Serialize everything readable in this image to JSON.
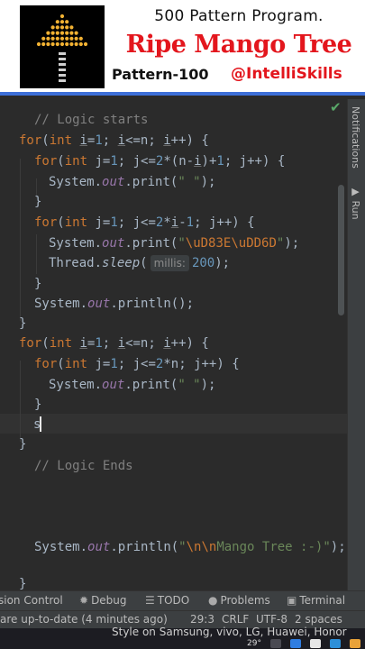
{
  "banner": {
    "subtitle": "500 Pattern Program.",
    "title": "Ripe Mango Tree",
    "pattern": "Pattern-100",
    "handle": "@IntelliSkills",
    "colors": {
      "title": "#e3161d",
      "border": "#3d6fd8",
      "tree": "#f2b233"
    }
  },
  "editor": {
    "comment_start": "// Logic starts",
    "comment_end": "// Logic Ends",
    "typed": "s",
    "hint_label": "millis:",
    "println_call": "System.out.println(\"\\n\\nMango Tree :-)\");",
    "mango_escape": "\\uD83E\\uDD6D",
    "colors": {
      "keyword": "#cc7832",
      "string": "#6a8759",
      "number": "#6897bb",
      "field": "#9876aa",
      "comment": "#808080"
    }
  },
  "right_panel": {
    "tab_notifications": "Notifications",
    "tab_run": "Run"
  },
  "toolbar": {
    "version_control": "sion Control",
    "debug": "Debug",
    "todo": "TODO",
    "problems": "Problems",
    "terminal": "Terminal"
  },
  "status": {
    "message": "are up-to-date (4 minutes ago)",
    "position": "29:3",
    "line_sep": "CRLF",
    "encoding": "UTF-8",
    "indent": "2 spaces"
  },
  "overlay": {
    "caption": "Style on Samsung, vivo, LG, Huawei, Honor",
    "temperature": "29°"
  }
}
